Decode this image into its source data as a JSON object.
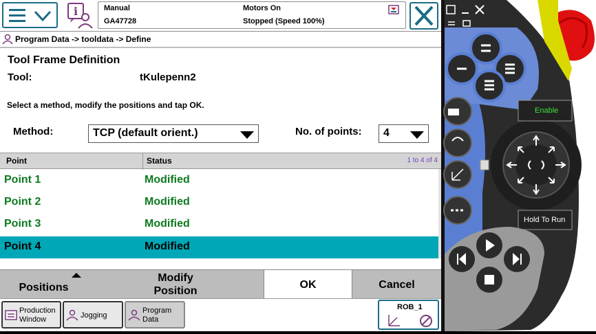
{
  "status": {
    "mode": "Manual",
    "controller": "GA47728",
    "motors": "Motors On",
    "state": "Stopped (Speed 100%)"
  },
  "breadcrumb": "Program Data -> tooldata -> Define",
  "form": {
    "title": "Tool Frame Definition",
    "tool_label": "Tool:",
    "tool_value": "tKulepenn2",
    "instruction": "Select a method, modify the positions and tap OK.",
    "method_label": "Method:",
    "method_value": "TCP (default orient.)",
    "points_label": "No. of points:",
    "points_value": "4"
  },
  "table": {
    "headers": [
      "Point",
      "Status"
    ],
    "count": "1 to 4 of 4",
    "rows": [
      {
        "point": "Point  1",
        "status": "Modified"
      },
      {
        "point": "Point  2",
        "status": "Modified"
      },
      {
        "point": "Point  3",
        "status": "Modified"
      },
      {
        "point": "Point  4",
        "status": "Modified"
      }
    ],
    "selected_row": 4
  },
  "commands": {
    "positions": "Positions",
    "modify_line1": "Modify",
    "modify_line2": "Position",
    "ok": "OK",
    "cancel": "Cancel"
  },
  "taskbar": {
    "production_line1": "Production",
    "production_line2": "Window",
    "jogging": "Jogging",
    "program_line1": "Program",
    "program_line2": "Data",
    "robot": "ROB_1"
  },
  "pendant": {
    "enable": "Enable",
    "hold_to_run": "Hold To Run"
  },
  "colors": {
    "accent": "#1a6c86",
    "selection": "#00a7b6",
    "status_text": "#0c7a1f",
    "pendant_blue": "#5a7fd2",
    "emergency_red": "#e01010"
  }
}
